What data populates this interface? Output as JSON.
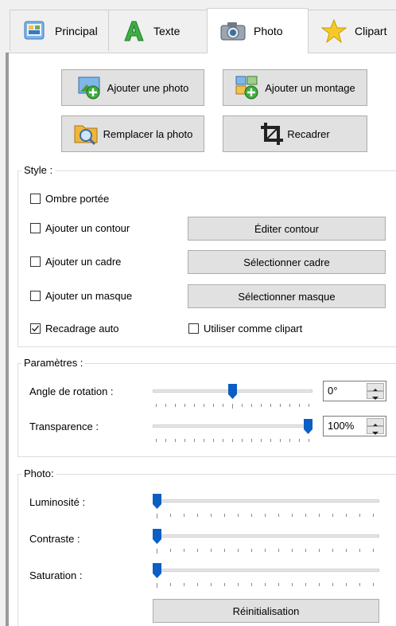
{
  "tabs": [
    {
      "label": "Principal",
      "icon": "home-screen-icon",
      "active": false
    },
    {
      "label": "Texte",
      "icon": "letter-a-icon",
      "active": false
    },
    {
      "label": "Photo",
      "icon": "camera-icon",
      "active": true
    },
    {
      "label": "Clipart",
      "icon": "star-icon",
      "active": false
    }
  ],
  "actions": {
    "add_photo": "Ajouter une photo",
    "add_montage": "Ajouter un montage",
    "replace_photo": "Remplacer la photo",
    "crop": "Recadrer"
  },
  "style": {
    "title": "Style :",
    "drop_shadow": {
      "label": "Ombre portée",
      "checked": false
    },
    "add_outline": {
      "label": "Ajouter un contour",
      "checked": false
    },
    "edit_outline_button": "Éditer contour",
    "add_frame": {
      "label": "Ajouter un cadre",
      "checked": false
    },
    "select_frame_button": "Sélectionner cadre",
    "add_mask": {
      "label": "Ajouter un masque",
      "checked": false
    },
    "select_mask_button": "Sélectionner masque",
    "auto_crop": {
      "label": "Recadrage auto",
      "checked": true
    },
    "use_as_clipart": {
      "label": "Utiliser comme clipart",
      "checked": false
    }
  },
  "parameters": {
    "title": "Paramètres :",
    "rotation": {
      "label": "Angle de rotation :",
      "value_text": "0°",
      "level": 0.5
    },
    "transparency": {
      "label": "Transparence :",
      "value_text": "100%",
      "level": 1.0
    }
  },
  "photo": {
    "title": "Photo:",
    "brightness": {
      "label": "Luminosité :",
      "level": 0.0
    },
    "contrast": {
      "label": "Contraste :",
      "level": 0.0
    },
    "saturation": {
      "label": "Saturation :",
      "level": 0.0
    },
    "reset_button": "Réinitialisation"
  },
  "colors": {
    "accent": "#0b5fc4",
    "button_bg": "#e1e1e1",
    "tab_active_bg": "#ffffff"
  }
}
